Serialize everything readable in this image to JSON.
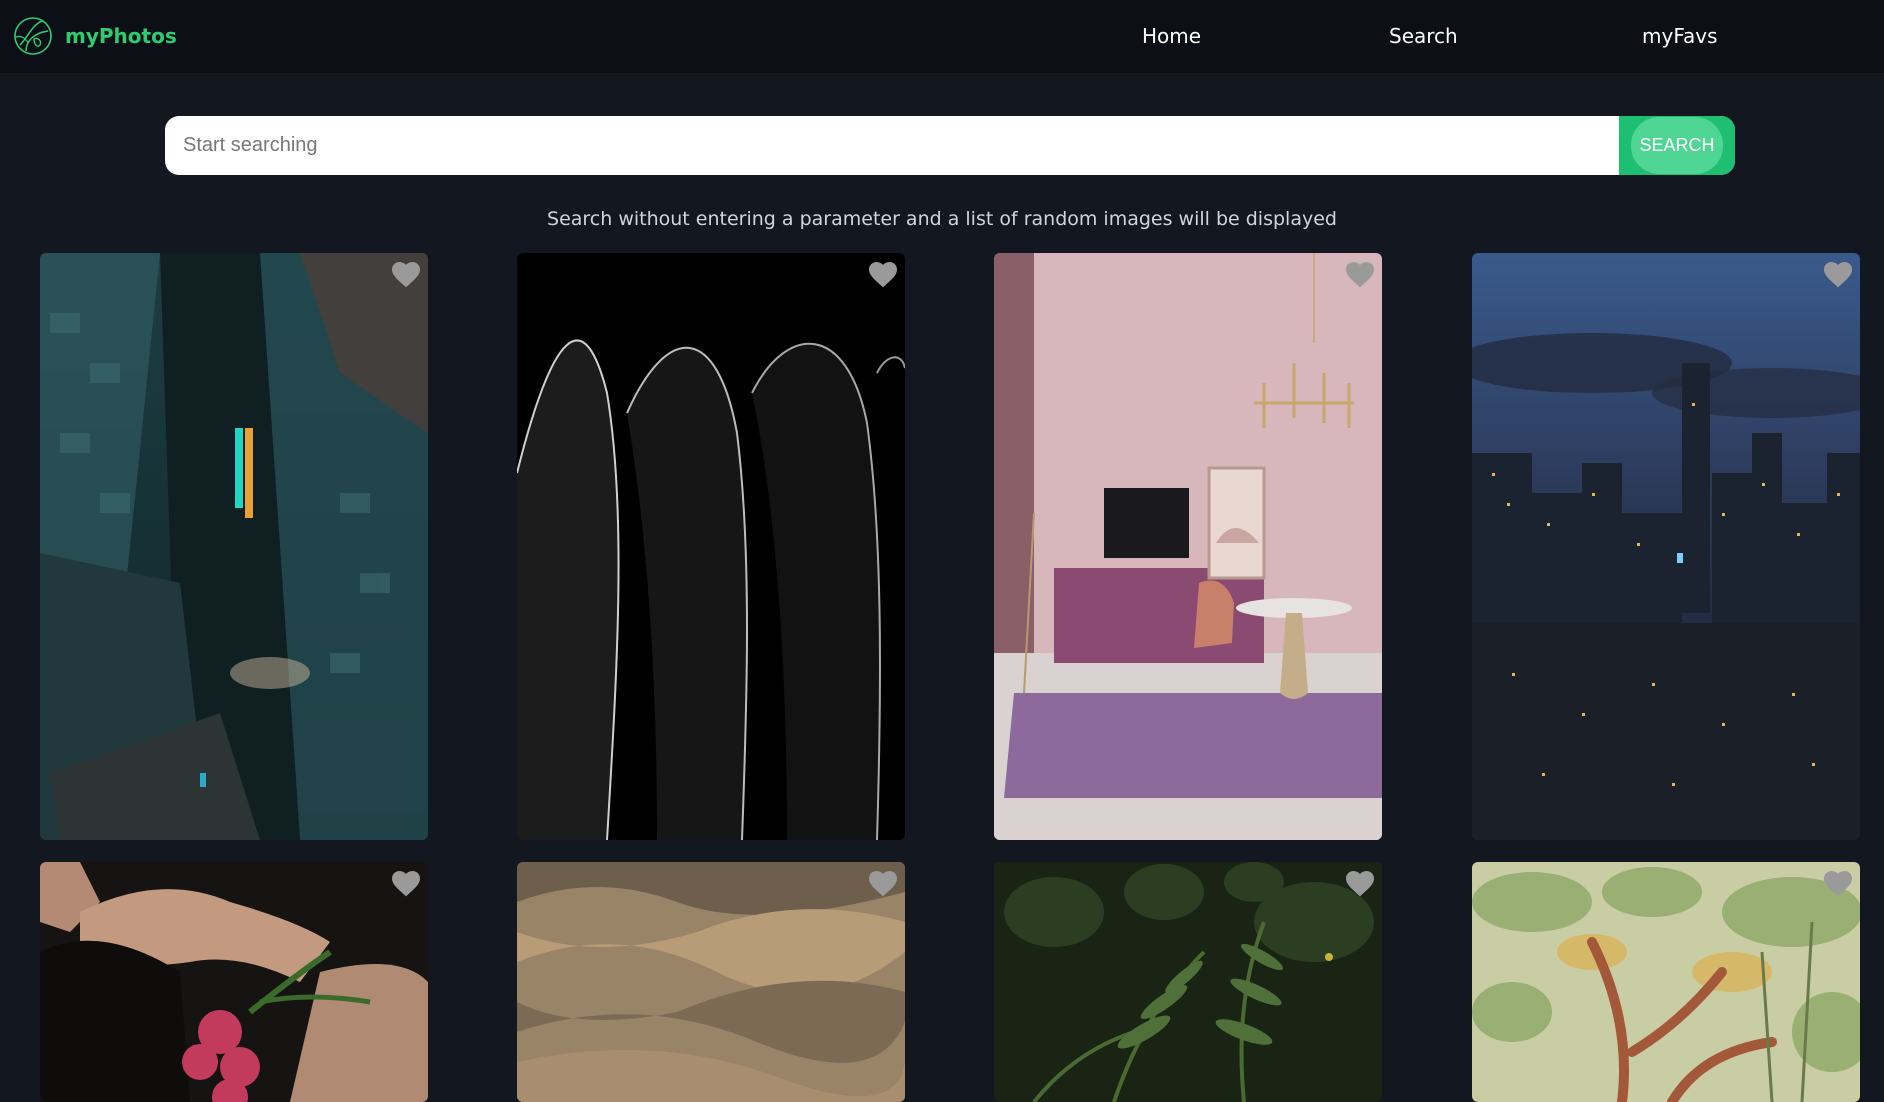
{
  "app": {
    "name": "myPhotos"
  },
  "nav": {
    "home": "Home",
    "search": "Search",
    "favs": "myFavs"
  },
  "search": {
    "placeholder": "Start searching",
    "value": "",
    "button_label": "SEARCH"
  },
  "hint": "Search without entering a parameter and a list of random images will be displayed",
  "colors": {
    "background": "#131720",
    "navbar": "#0c0f16",
    "brand": "#2ecc71",
    "search_button": "#1fbf71",
    "favorite_icon": "#9a9a9a"
  },
  "photos": [
    {
      "subject": "aerial view of city street at dusk with neon ristorante sign",
      "favorited": false,
      "sign_text": "RISTORANTE"
    },
    {
      "subject": "abstract black curved shapes with white edges",
      "favorited": false
    },
    {
      "subject": "pink interior room with purple rug, cabinet, tv, chair and table",
      "favorited": false
    },
    {
      "subject": "city skyline at dusk with skyscrapers",
      "favorited": false
    },
    {
      "subject": "person in black dress holding pink flowers",
      "favorited": false
    },
    {
      "subject": "sand dunes close-up",
      "favorited": false
    },
    {
      "subject": "green fern leaves",
      "favorited": false
    },
    {
      "subject": "painting of palm trees and jungle",
      "favorited": false
    }
  ]
}
